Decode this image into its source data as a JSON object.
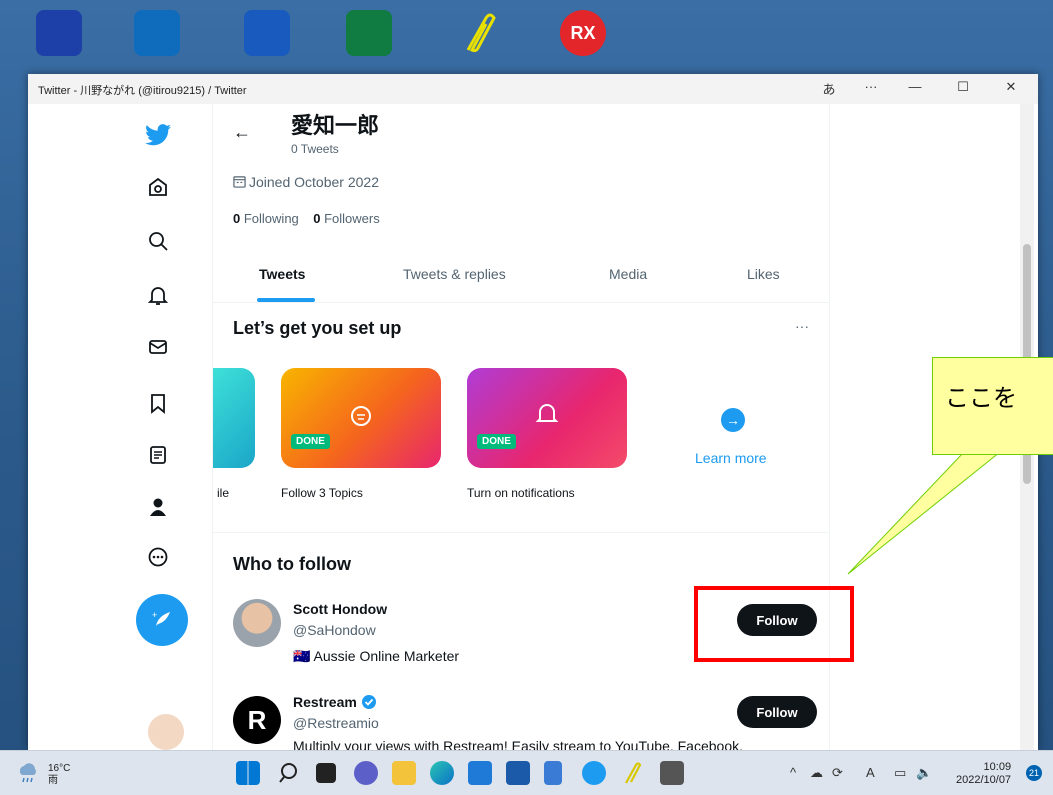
{
  "window": {
    "title": "Twitter - 川野ながれ (@itirou9215) / Twitter",
    "ime": "あ",
    "more": "···",
    "minimize": "—",
    "maximize": "☐",
    "close": "✕"
  },
  "profile": {
    "back": "←",
    "name": "愛知一郎",
    "tweets": "0 Tweets",
    "joined": "Joined October 2022",
    "following_count": "0",
    "following_label": "Following",
    "followers_count": "0",
    "followers_label": "Followers"
  },
  "tabs": [
    "Tweets",
    "Tweets & replies",
    "Media",
    "Likes"
  ],
  "setup": {
    "title": "Let’s get you set up",
    "more": "···",
    "done_label": "DONE",
    "cards": [
      {
        "label": "ile"
      },
      {
        "label": "Follow 3 Topics"
      },
      {
        "label": "Turn on notifications"
      }
    ],
    "learn_more": "Learn more"
  },
  "who_to_follow": {
    "title": "Who to follow",
    "people": [
      {
        "name": "Scott Hondow",
        "handle": "@SaHondow",
        "bio": "🇦🇺 Aussie Online Marketer",
        "button": "Follow"
      },
      {
        "name": "Restream",
        "handle": "@Restreamio",
        "bio": "Multiply your views with Restream! Easily stream to YouTube, Facebook,",
        "button": "Follow",
        "avatar_letter": "R"
      }
    ]
  },
  "annotation": {
    "callout_text": "ここを"
  },
  "taskbar": {
    "temperature": "16°C",
    "weather": "雨",
    "time": "10:09",
    "date": "2022/10/07",
    "notifications": "21",
    "ime": "A"
  },
  "colors": {
    "twitter_blue": "#1d9bf0",
    "dark": "#0f1419",
    "done_green": "#00ba7c",
    "annotation_red": "#ff0000"
  }
}
